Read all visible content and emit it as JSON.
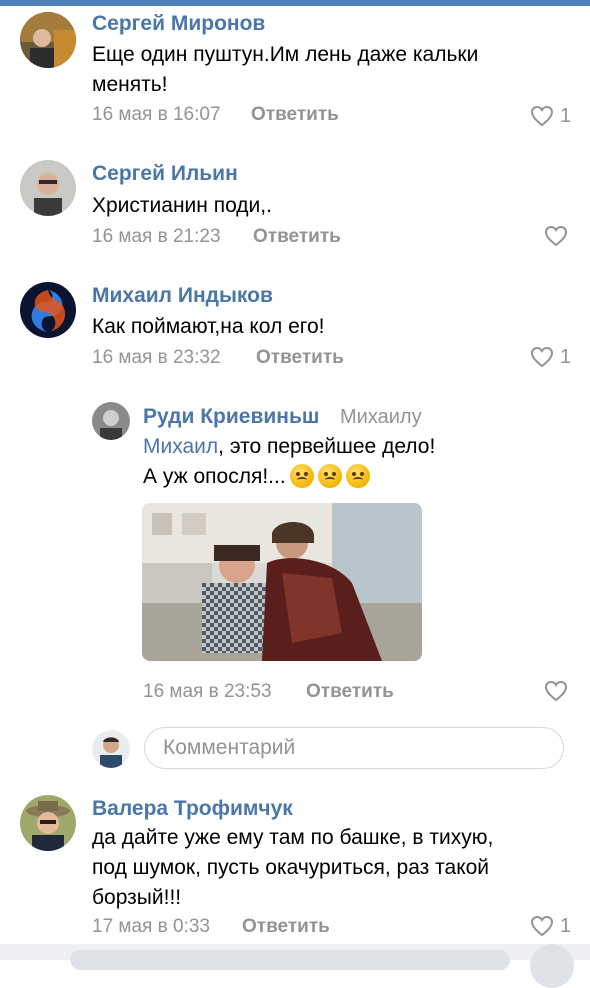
{
  "comments": [
    {
      "author": "Сергей Миронов",
      "text": "Еще один пуштун.Им лень даже кальки\nменять!",
      "date": "16 мая в 16:07",
      "reply_label": "Ответить",
      "likes": "1"
    },
    {
      "author": "Сергей Ильин",
      "text": "Христианин поди,.",
      "date": "16 мая в 21:23",
      "reply_label": "Ответить",
      "likes": ""
    },
    {
      "author": "Михаил Индыков",
      "text": "Как поймают,на кол его!",
      "date": "16 мая в 23:32",
      "reply_label": "Ответить",
      "likes": "1"
    }
  ],
  "reply": {
    "author": "Руди Криевиньш",
    "to": "Михаилу",
    "mention": "Михаил",
    "text_after_mention": ", это первейшее дело!",
    "line2": "А уж опосля!...",
    "date": "16 мая в 23:53",
    "reply_label": "Ответить",
    "likes": ""
  },
  "comment_input": {
    "placeholder": "Комментарий"
  },
  "last_comment": {
    "author": "Валера Трофимчук",
    "text": "да дайте уже ему там по башке, в тихую,\nпод шумок, пусть окачуриться, раз такой\nборзый!!!",
    "date": "17 мая в 0:33",
    "reply_label": "Ответить",
    "likes": "1"
  },
  "colors": {
    "link": "#4a76a8",
    "meta": "#939393",
    "accent": "#5181b8"
  }
}
